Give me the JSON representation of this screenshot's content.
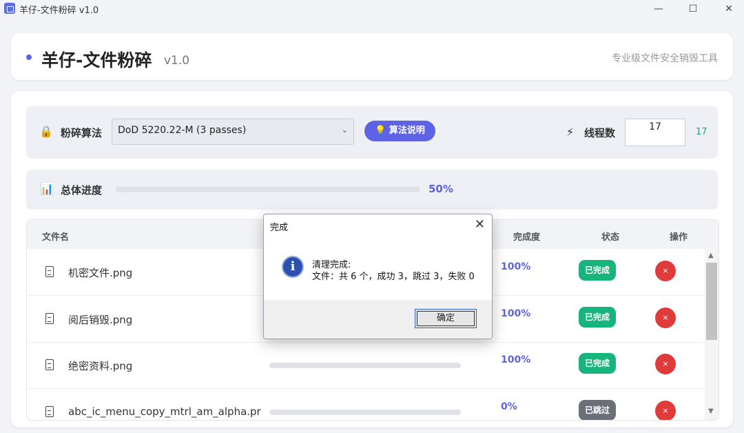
{
  "window": {
    "title": "羊仔-文件粉碎 v1.0",
    "minimize": "—",
    "maximize": "☐",
    "close": "✕"
  },
  "header": {
    "title": "羊仔-文件粉碎",
    "version": "v1.0",
    "subtitle": "专业级文件安全销毁工具"
  },
  "algorithm": {
    "label": "粉碎算法",
    "selected": "DoD 5220.22-M (3 passes)",
    "help_button": "💡 算法说明"
  },
  "threads": {
    "label": "线程数",
    "input_value": "17",
    "display_value": "17"
  },
  "progress": {
    "label": "总体进度",
    "percent_text": "50%",
    "value": 0.5
  },
  "table": {
    "headers": {
      "filename": "文件名",
      "progress": "完成度",
      "status": "状态",
      "action": "操作"
    },
    "rows": [
      {
        "name": "机密文件.png",
        "percent": "100%",
        "status": "已完成",
        "action": "×"
      },
      {
        "name": "阅后销毁.png",
        "percent": "100%",
        "status": "已完成",
        "action": "×"
      },
      {
        "name": "绝密资料.png",
        "percent": "100%",
        "status": "已完成",
        "action": "×"
      },
      {
        "name": "abc_ic_menu_copy_mtrl_am_alpha.pr",
        "percent": "0%",
        "status": "已跳过",
        "action": "×"
      }
    ]
  },
  "dialog": {
    "title": "完成",
    "close": "✕",
    "icon": "i",
    "message_line1": "清理完成:",
    "message_line2": "文件：共 6 个，成功 3，跳过 3，失败 0",
    "ok_button": "确定"
  }
}
